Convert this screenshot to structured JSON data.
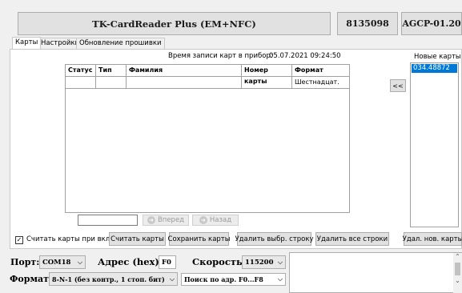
{
  "header": {
    "device_name": "TK-CardReader Plus (EM+NFC)",
    "serial": "8135098",
    "firmware": "AGCP-01.20"
  },
  "tabs": [
    {
      "label": "Карты"
    },
    {
      "label": "Настройки"
    },
    {
      "label": "Обновление прошивки"
    }
  ],
  "cards": {
    "write_time_label": "Время записи карт в прибор:",
    "write_time_value": "05.07.2021 09:24:50",
    "columns": [
      "Статус",
      "Тип",
      "Фамилия",
      "Номер карты",
      "Формат"
    ],
    "rows": [
      {
        "status": "",
        "type": "",
        "surname": "",
        "number": "",
        "format": "Шестнадцат."
      }
    ],
    "search_value": "",
    "forward_label": "Вперед",
    "back_label": "Назад"
  },
  "new_cards": {
    "title": "Новые карты",
    "items": [
      "034.48872"
    ],
    "move_label": "<<",
    "delete_new_label": "Удал. нов. карты"
  },
  "actions": {
    "read_on_start_label": "Считать карты при вкл.",
    "read_on_start_checked": true,
    "read_cards": "Считать карты",
    "save_cards": "Сохранить карты",
    "delete_selected": "Удалить выбр. строку",
    "delete_all": "Удалить все строки"
  },
  "connection": {
    "port_label": "Порт:",
    "port_value": "COM18",
    "address_label": "Адрес (hex):",
    "address_value": "F0",
    "speed_label": "Скорость:",
    "speed_value": "115200",
    "format_label": "Формат:",
    "format_value": "8-N-1 (без контр., 1 стоп. бит)",
    "search_mode_value": "Поиск по адр. F0...F8"
  },
  "colors": {
    "accent": "#0078d7",
    "brand_text": "#1a1a1a",
    "panel_bg": "#f0f0f0"
  }
}
